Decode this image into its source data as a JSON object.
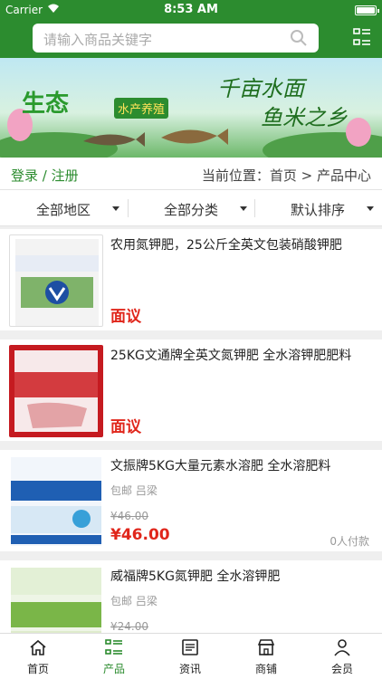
{
  "status": {
    "carrier": "Carrier",
    "time": "8:53 AM"
  },
  "search": {
    "placeholder": "请输入商品关键字"
  },
  "banner": {
    "title": "生态",
    "sub": "水产养殖",
    "slogan1": "千亩水面",
    "slogan2": "鱼米之乡"
  },
  "location": {
    "login": "登录 / 注册",
    "breadcrumb": "当前位置：首页 > 产品中心"
  },
  "filters": [
    "全部地区",
    "全部分类",
    "默认排序"
  ],
  "products": [
    {
      "title": "农用氮钾肥，25公斤全英文包装硝酸钾肥",
      "price": "面议"
    },
    {
      "title": "25KG文通牌全英文氮钾肥 全水溶钾肥肥料",
      "price": "面议"
    },
    {
      "title": "文振牌5KG大量元素水溶肥 全水溶肥料",
      "meta": "包邮 吕梁",
      "old_price": "¥46.00",
      "price": "¥46.00",
      "sold": "0人付款"
    },
    {
      "title": "威福牌5KG氮钾肥 全水溶钾肥",
      "meta": "包邮 吕梁",
      "old_price": "¥24.00"
    }
  ],
  "tabs": [
    "首页",
    "产品",
    "资讯",
    "商铺",
    "会员"
  ],
  "colors": {
    "brand": "#2c8c2f",
    "price": "#e0261b"
  }
}
